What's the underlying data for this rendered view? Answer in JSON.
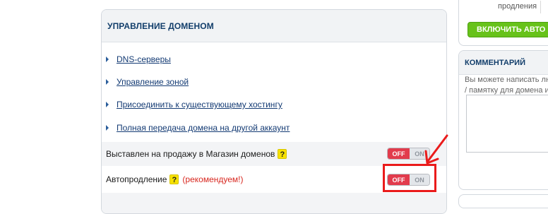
{
  "domain_panel": {
    "title": "УПРАВЛЕНИЕ ДОМЕНОМ",
    "links": [
      {
        "label": "DNS-серверы"
      },
      {
        "label": "Управление зоной"
      },
      {
        "label": "Присоединить к существующему хостингу"
      },
      {
        "label": "Полная передача домена на другой аккаунт"
      }
    ],
    "settings": [
      {
        "label": "Выставлен на продажу в Магазин доменов",
        "help": "?",
        "toggle": {
          "off": "OFF",
          "on": "ON",
          "state": "off"
        }
      },
      {
        "label": "Автопродление",
        "help": "?",
        "note": "(рекомендуем!)",
        "toggle": {
          "off": "OFF",
          "on": "ON",
          "state": "off"
        }
      }
    ],
    "highlight_color": "#ea1b1b"
  },
  "right_column": {
    "renew_label": "продления",
    "enable_button": "ВКЛЮЧИТЬ АВТО",
    "comment": {
      "title": "КОММЕНТАРИЙ",
      "description_line1": "Вы можете написать лю",
      "description_line2": "/ памятку для домена и"
    }
  },
  "colors": {
    "accent_text": "#123e6b",
    "toggle_off": "#e23b4c",
    "button_green": "#67c21a",
    "recommend_red": "#d8271f"
  }
}
